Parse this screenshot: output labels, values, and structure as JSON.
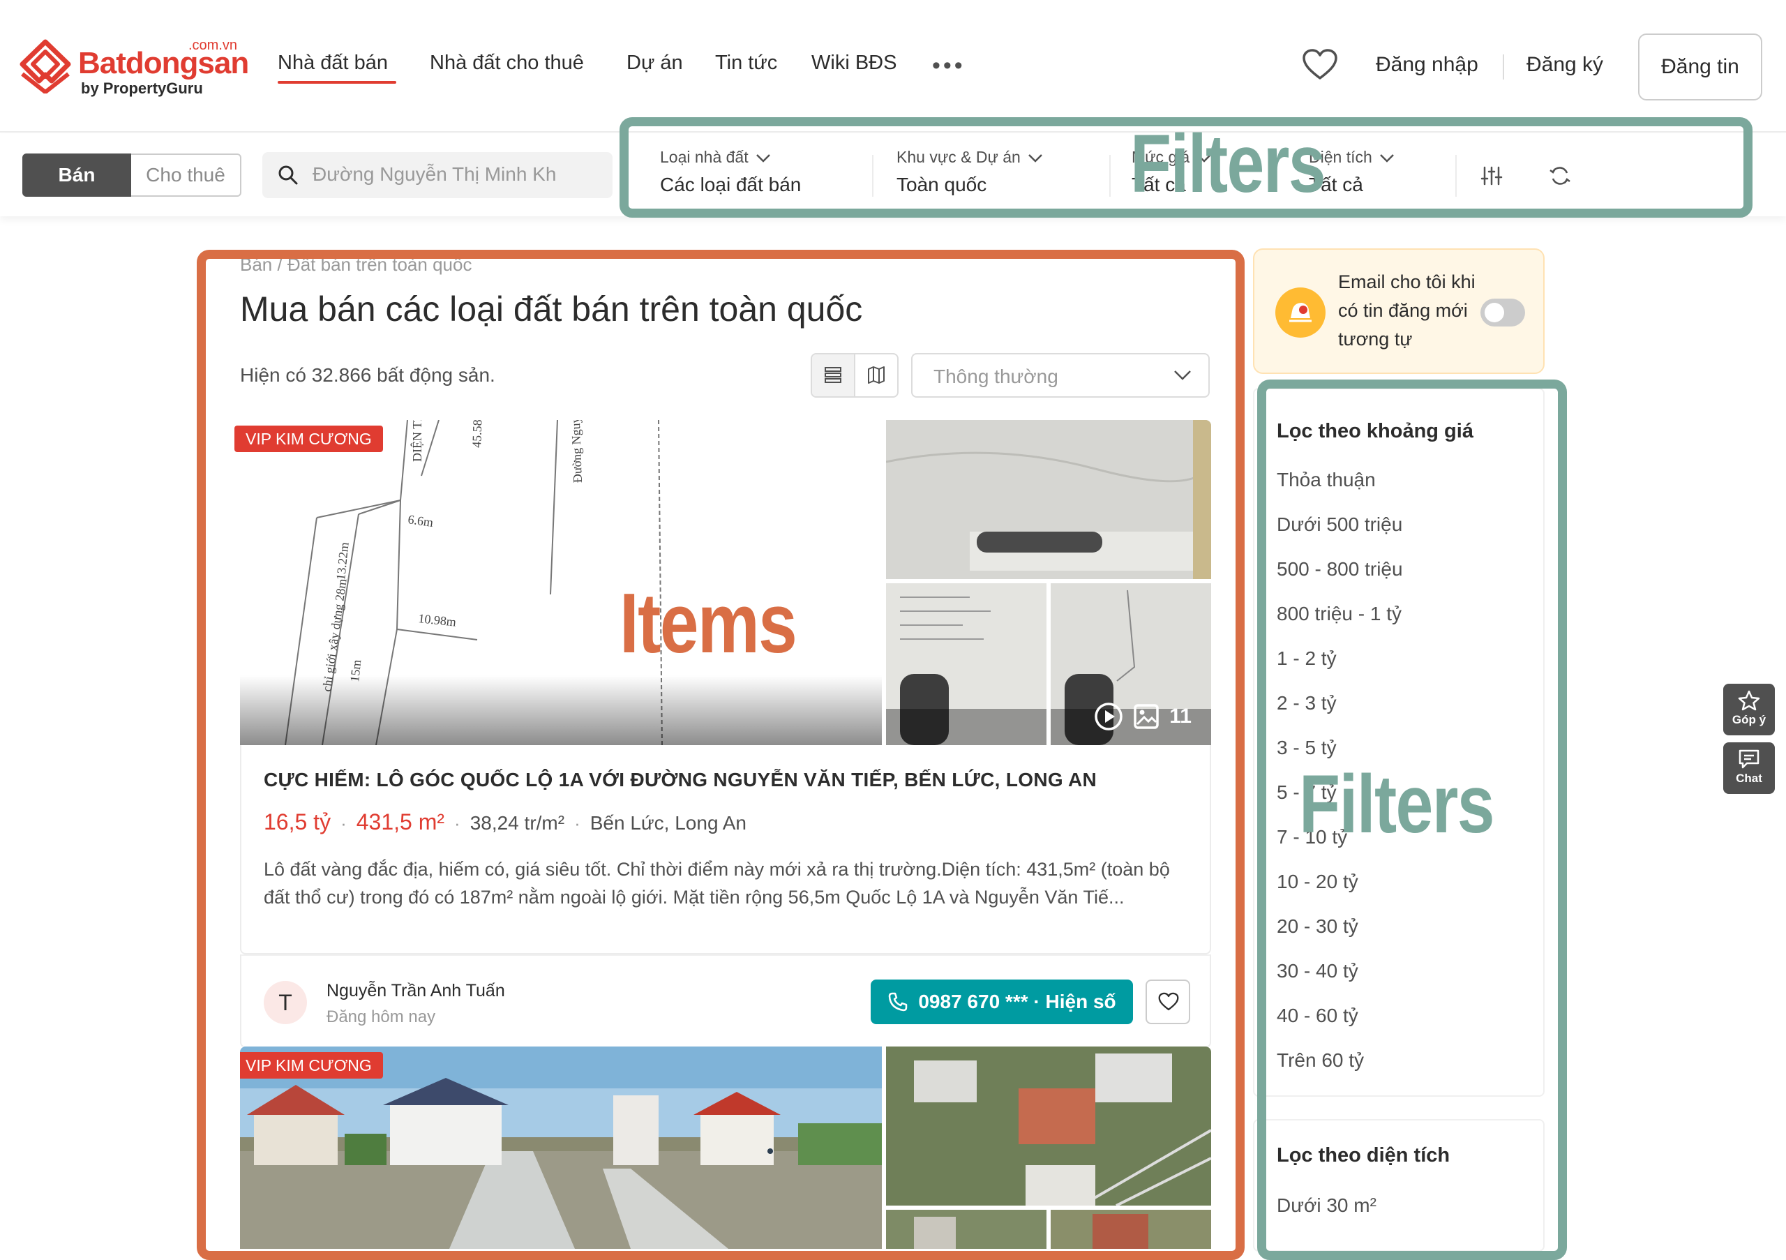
{
  "header": {
    "logo": {
      "brand": "Batdongsan",
      "suffix": ".com.vn",
      "byline": "by PropertyGuru"
    },
    "nav": [
      {
        "label": "Nhà đất bán",
        "active": true
      },
      {
        "label": "Nhà đất cho thuê"
      },
      {
        "label": "Dự án"
      },
      {
        "label": "Tin tức"
      },
      {
        "label": "Wiki BĐS"
      }
    ],
    "more": "•••",
    "login": "Đăng nhập",
    "register": "Đăng ký",
    "post": "Đăng tin"
  },
  "search": {
    "tabs": [
      "Bán",
      "Cho thuê"
    ],
    "placeholder": "Đường Nguyễn Thị Minh Kh",
    "filters": [
      {
        "label": "Loại nhà đất",
        "value": "Các loại đất bán"
      },
      {
        "label": "Khu vực & Dự án",
        "value": "Toàn quốc"
      },
      {
        "label": "Mức giá",
        "value": "Tất cả"
      },
      {
        "label": "Diện tích",
        "value": "Tất cả"
      }
    ]
  },
  "annotations": {
    "filters_top": "Filters",
    "items": "Items",
    "filters_side": "Filters"
  },
  "main": {
    "breadcrumb": "Bán / Đất bán trên toàn quốc",
    "title": "Mua bán các loại đất bán trên toàn quốc",
    "count": "Hiện có 32.866 bất động sản.",
    "sort": "Thông thường"
  },
  "listings": [
    {
      "badge": "VIP KIM CƯƠNG",
      "image_count": "11",
      "title": "CỰC HIẾM: LÔ GÓC QUỐC LỘ 1A VỚI ĐƯỜNG NGUYỄN VĂN TIẾP, BẾN LỨC, LONG AN",
      "price": "16,5 tỷ",
      "area": "431,5 m²",
      "price_per_m2": "38,24 tr/m²",
      "location": "Bến Lức, Long An",
      "description": "Lô đất vàng đắc địa, hiếm có, giá siêu tốt. Chỉ thời điểm này mới xả ra thị trường.Diện tích: 431,5m² (toàn bộ đất thổ cư) trong đó có 187m² nằm ngoài lộ giới. Mặt tiền rộng 56,5m Quốc Lộ 1A và Nguyễn Văn Tiế...",
      "agent_initial": "T",
      "agent_name": "Nguyễn Trần Anh Tuấn",
      "posted": "Đăng hôm nay",
      "phone": "0987 670 *** · Hiện số"
    },
    {
      "badge": "VIP KIM CƯƠNG"
    }
  ],
  "sidebar": {
    "email_alert": "Email cho tôi khi có tin đăng mới tương tự",
    "price_filter": {
      "title": "Lọc theo khoảng giá",
      "items": [
        "Thỏa thuận",
        "Dưới 500 triệu",
        "500 - 800 triệu",
        "800 triệu - 1 tỷ",
        "1 - 2 tỷ",
        "2 - 3 tỷ",
        "3 - 5 tỷ",
        "5 - 7 tỷ",
        "7 - 10 tỷ",
        "10 - 20 tỷ",
        "20 - 30 tỷ",
        "30 - 40 tỷ",
        "40 - 60 tỷ",
        "Trên 60 tỷ"
      ]
    },
    "area_filter": {
      "title": "Lọc theo diện tích",
      "items": [
        "Dưới 30 m²"
      ]
    }
  },
  "floating": {
    "feedback": "Góp ý",
    "chat": "Chat"
  },
  "colors": {
    "brand": "#e03c31",
    "teal": "#009ba1",
    "anno_teal": "#7ba89c",
    "anno_orange": "#d96e45"
  }
}
